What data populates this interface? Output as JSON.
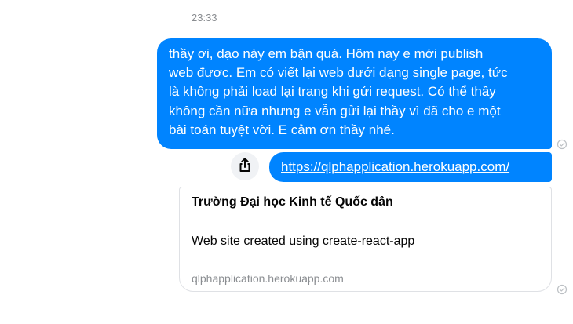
{
  "conversation": {
    "timestamp": "23:33",
    "message_text": "thầy ơi, dạo này em bận quá. Hôm nay e mới publish\nweb được. Em có viết lại web dưới dạng single page, tức\nlà không phải load lại trang khi gửi request. Có thể thầy\nkhông cần nữa nhưng e vẫn gửi lại thầy vì đã cho e một\nbài toán tuyệt vời. E cảm ơn thầy nhé.",
    "link_text": "https://qlphapplication.herokuapp.com/",
    "preview": {
      "title": "Trường Đại học Kinh tế Quốc dân",
      "description": "Web site created using create-react-app",
      "domain": "qlphapplication.herokuapp.com"
    }
  },
  "icons": {
    "share": "share-icon",
    "seen": "sent-check-icon"
  },
  "colors": {
    "bubble": "#0084ff",
    "bubble_text": "#ffffff",
    "muted": "#8a8d91",
    "share_bg": "#f0f2f5"
  }
}
